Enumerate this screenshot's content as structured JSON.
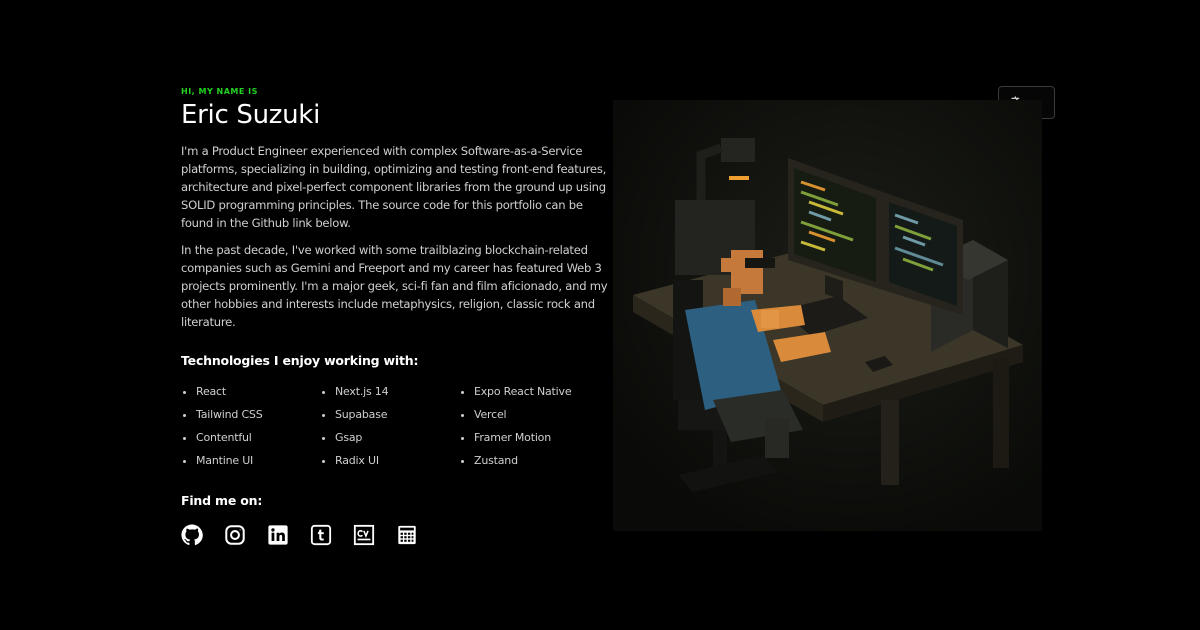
{
  "intro": {
    "eyebrow": "HI, MY NAME IS",
    "name": "Eric Suzuki",
    "paragraph_1": "I'm a Product Engineer experienced with complex Software-as-a-Service platforms, specializing in building, optimizing and testing front-end features, architecture and pixel-perfect component libraries from the ground up using SOLID programming principles. The source code for this portfolio can be found in the Github link below.",
    "paragraph_2": "In the past decade, I've worked with some trailblazing blockchain-related companies such as Gemini and Freeport and my career has featured Web 3 projects prominently. I'm a major geek, sci-fi fan and film aficionado, and my other hobbies and interests include metaphysics, religion, classic rock and literature."
  },
  "technologies": {
    "title": "Technologies I enjoy working with:",
    "items": [
      "React",
      "Next.js 14",
      "Expo React Native",
      "Tailwind CSS",
      "Supabase",
      "Vercel",
      "Contentful",
      "Gsap",
      "Framer Motion",
      "Mantine UI",
      "Radix UI",
      "Zustand"
    ]
  },
  "social": {
    "title": "Find me on:",
    "links": [
      {
        "icon": "github-icon"
      },
      {
        "icon": "instagram-icon"
      },
      {
        "icon": "linkedin-icon"
      },
      {
        "icon": "tumblr-icon"
      },
      {
        "icon": "cv-icon"
      },
      {
        "icon": "calendar-icon"
      }
    ]
  },
  "language_menu": {
    "icon": "translate-icon",
    "chevron": "chevron-down-icon"
  },
  "hero_image": {
    "subject": "voxel developer at desk with monitors"
  },
  "colors": {
    "background": "#000000",
    "accent": "#22d322",
    "text": "#d0d0d0",
    "heading": "#ffffff"
  }
}
